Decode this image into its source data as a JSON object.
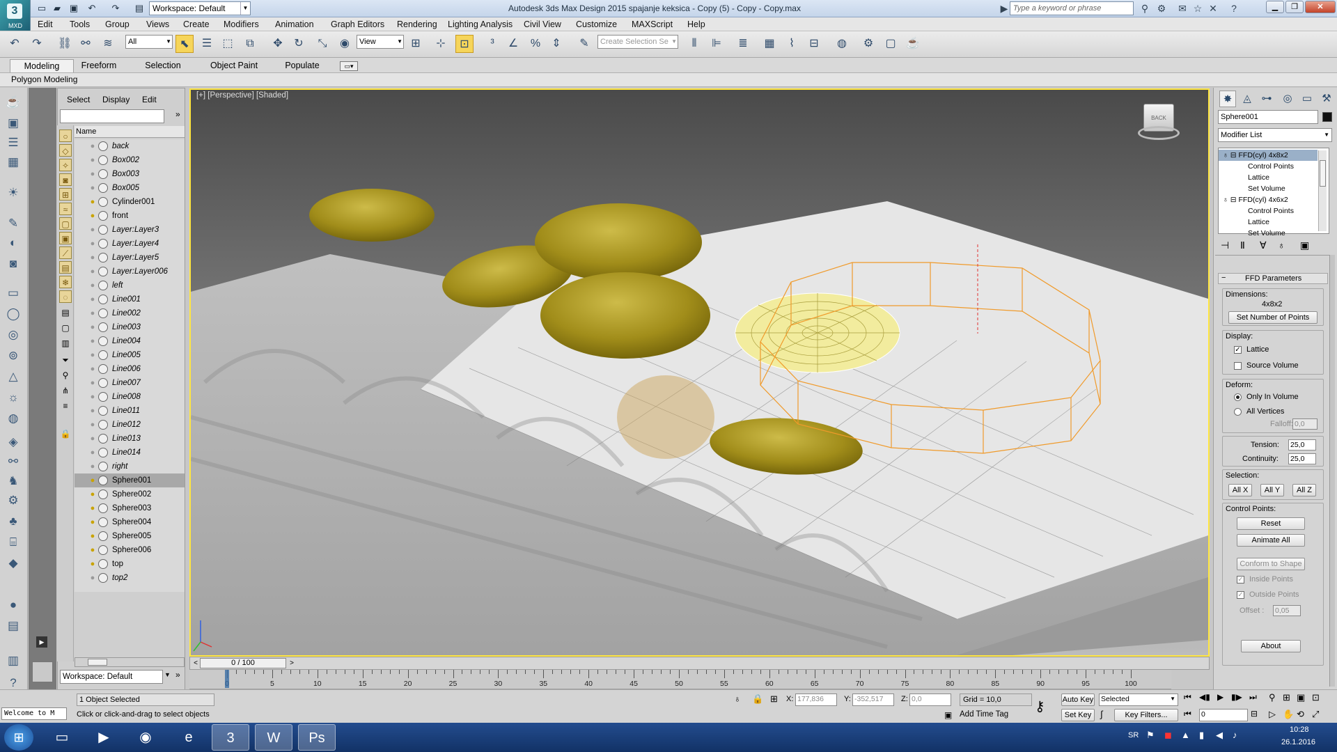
{
  "window": {
    "title": "Autodesk 3ds Max Design 2015     spajanje keksica - Copy (5) - Copy - Copy.max",
    "app_badge": "MXD",
    "workspace": "Workspace: Default",
    "search_placeholder": "Type a keyword or phrase"
  },
  "menu": [
    "Edit",
    "Tools",
    "Group",
    "Views",
    "Create",
    "Modifiers",
    "Animation",
    "Graph Editors",
    "Rendering",
    "Lighting Analysis",
    "Civil View",
    "Customize",
    "MAXScript",
    "Help"
  ],
  "toolbar": {
    "filter": "All",
    "refcoord": "View",
    "selection_set_placeholder": "Create Selection Se"
  },
  "ribbon": {
    "tabs": [
      "Modeling",
      "Freeform",
      "Selection",
      "Object Paint",
      "Populate"
    ],
    "panel": "Polygon Modeling"
  },
  "scene_explorer": {
    "menus": [
      "Select",
      "Display",
      "Edit"
    ],
    "column": "Name",
    "objects": [
      {
        "name": "back",
        "italic": true,
        "light": false
      },
      {
        "name": "Box002",
        "italic": true,
        "light": false
      },
      {
        "name": "Box003",
        "italic": true,
        "light": false
      },
      {
        "name": "Box005",
        "italic": true,
        "light": false
      },
      {
        "name": "Cylinder001",
        "italic": false,
        "light": true
      },
      {
        "name": "front",
        "italic": false,
        "light": true
      },
      {
        "name": "Layer:Layer3",
        "italic": true,
        "light": false
      },
      {
        "name": "Layer:Layer4",
        "italic": true,
        "light": false
      },
      {
        "name": "Layer:Layer5",
        "italic": true,
        "light": false
      },
      {
        "name": "Layer:Layer006",
        "italic": true,
        "light": false
      },
      {
        "name": "left",
        "italic": true,
        "light": false
      },
      {
        "name": "Line001",
        "italic": true,
        "light": false
      },
      {
        "name": "Line002",
        "italic": true,
        "light": false
      },
      {
        "name": "Line003",
        "italic": true,
        "light": false
      },
      {
        "name": "Line004",
        "italic": true,
        "light": false
      },
      {
        "name": "Line005",
        "italic": true,
        "light": false
      },
      {
        "name": "Line006",
        "italic": true,
        "light": false
      },
      {
        "name": "Line007",
        "italic": true,
        "light": false
      },
      {
        "name": "Line008",
        "italic": true,
        "light": false
      },
      {
        "name": "Line011",
        "italic": true,
        "light": false
      },
      {
        "name": "Line012",
        "italic": true,
        "light": false
      },
      {
        "name": "Line013",
        "italic": true,
        "light": false
      },
      {
        "name": "Line014",
        "italic": true,
        "light": false
      },
      {
        "name": "right",
        "italic": true,
        "light": false
      },
      {
        "name": "Sphere001",
        "italic": false,
        "light": true,
        "selected": true
      },
      {
        "name": "Sphere002",
        "italic": false,
        "light": true
      },
      {
        "name": "Sphere003",
        "italic": false,
        "light": true
      },
      {
        "name": "Sphere004",
        "italic": false,
        "light": true
      },
      {
        "name": "Sphere005",
        "italic": false,
        "light": true
      },
      {
        "name": "Sphere006",
        "italic": false,
        "light": true
      },
      {
        "name": "top",
        "italic": false,
        "light": true
      },
      {
        "name": "top2",
        "italic": true,
        "light": false
      }
    ],
    "workspace": "Workspace: Default"
  },
  "viewport": {
    "label": "[+] [Perspective] [Shaded]",
    "viewcube_face": "BACK"
  },
  "command_panel": {
    "object_name": "Sphere001",
    "modifier_list": "Modifier List",
    "stack": [
      {
        "label": "FFD(cyl) 4x8x2",
        "level": 0,
        "selected": true
      },
      {
        "label": "Control Points",
        "level": 1
      },
      {
        "label": "Lattice",
        "level": 1
      },
      {
        "label": "Set Volume",
        "level": 1
      },
      {
        "label": "FFD(cyl) 4x6x2",
        "level": 0
      },
      {
        "label": "Control Points",
        "level": 1
      },
      {
        "label": "Lattice",
        "level": 1
      },
      {
        "label": "Set Volume",
        "level": 1
      }
    ],
    "rollout_title": "FFD Parameters",
    "dimensions_label": "Dimensions:",
    "dimensions_value": "4x8x2",
    "set_points_button": "Set Number of Points",
    "display_label": "Display:",
    "lattice_label": "Lattice",
    "lattice_checked": true,
    "source_volume_label": "Source Volume",
    "source_volume_checked": false,
    "deform_label": "Deform:",
    "only_in_volume_label": "Only In Volume",
    "all_vertices_label": "All Vertices",
    "deform_mode": "Only In Volume",
    "falloff_label": "Falloff:",
    "falloff_value": "0,0",
    "tension_label": "Tension:",
    "tension_value": "25,0",
    "continuity_label": "Continuity:",
    "continuity_value": "25,0",
    "selection_label": "Selection:",
    "selection_buttons": [
      "All X",
      "All Y",
      "All Z"
    ],
    "control_points_label": "Control Points:",
    "reset_button": "Reset",
    "animate_all_button": "Animate All",
    "conform_button": "Conform to Shape",
    "inside_points_label": "Inside Points",
    "outside_points_label": "Outside Points",
    "offset_label": "Offset :",
    "offset_value": "0,05",
    "about_button": "About"
  },
  "timeline": {
    "frame": "0 / 100",
    "ticks": [
      0,
      5,
      10,
      15,
      20,
      25,
      30,
      35,
      40,
      45,
      50,
      55,
      60,
      65,
      70,
      75,
      80,
      85,
      90,
      95,
      100
    ],
    "max_frame": 100
  },
  "status": {
    "welcome": "Welcome to M",
    "selection": "1 Object Selected",
    "prompt": "Click or click-and-drag to select objects",
    "x_label": "X:",
    "x": "177,836",
    "y_label": "Y:",
    "y": "-352,517",
    "z_label": "Z:",
    "z": "0,0",
    "grid": "Grid = 10,0",
    "add_time_tag": "Add Time Tag",
    "auto_key": "Auto Key",
    "set_key": "Set Key",
    "key_mode": "Selected",
    "key_filters": "Key Filters...",
    "current_frame": "0"
  },
  "taskbar": {
    "language": "SR",
    "time": "10:28",
    "date": "26.1.2016"
  }
}
